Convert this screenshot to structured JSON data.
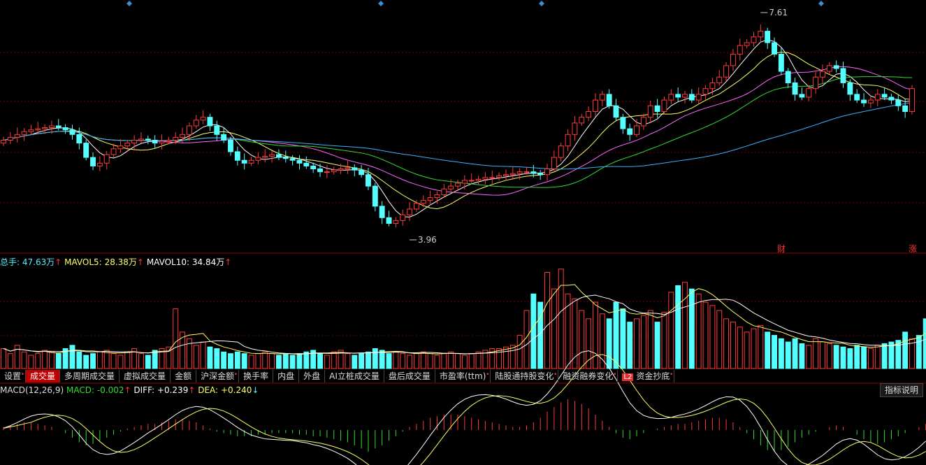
{
  "price_high_label": "7.61",
  "price_low_label": "3.96",
  "badge_cai": "财",
  "badge_zhang": "涨",
  "volume_legend": {
    "total_label": "总手:",
    "total_value": "47.63万",
    "mavol5_label": "MAVOL5:",
    "mavol5_value": "28.38万",
    "mavol10_label": "MAVOL10:",
    "mavol10_value": "34.84万",
    "arrow": "↑"
  },
  "tabs": [
    {
      "label": "设置",
      "dot": true
    },
    {
      "label": "成交量",
      "active": true
    },
    {
      "label": "多周期成交量"
    },
    {
      "label": "虚拟成交量"
    },
    {
      "label": "金额"
    },
    {
      "label": "沪深金额",
      "dot": true
    },
    {
      "label": "换手率"
    },
    {
      "label": "内盘"
    },
    {
      "label": "外盘"
    },
    {
      "label": "AI立桩成交量"
    },
    {
      "label": "盘后成交量"
    },
    {
      "label": "市盈率(ttm)",
      "dot": true
    },
    {
      "label": "陆股通持股变化",
      "dot": true
    },
    {
      "label": "融资融券变化",
      "dot": true
    },
    {
      "label": "资金抄底",
      "l2": "L2",
      "dot": true
    }
  ],
  "macd_legend": {
    "name": "MACD(12,26,9)",
    "macd_label": "MACD:",
    "macd_value": "-0.002",
    "diff_label": "DIFF:",
    "diff_value": "+0.239",
    "dea_label": "DEA:",
    "dea_value": "+0.240",
    "up_arrow": "↑",
    "down_arrow": "↓"
  },
  "help_button": "指标说明",
  "colors": {
    "up": "#ff3b3b",
    "down": "#54ffff",
    "ma5": "#ffffff",
    "ma10": "#ffff66",
    "ma20": "#ff66ff",
    "ma30": "#33dd33",
    "ma60": "#3ab0ff",
    "grid": "#7a0000",
    "macd_pos": "#ff3b3b",
    "macd_neg": "#33dd33"
  },
  "chart_data": {
    "type": "candlestick",
    "price_range": [
      3.96,
      7.61
    ],
    "closes": [
      5.5,
      5.55,
      5.6,
      5.65,
      5.68,
      5.7,
      5.72,
      5.75,
      5.72,
      5.68,
      5.6,
      5.45,
      5.2,
      5.05,
      5.1,
      5.25,
      5.35,
      5.4,
      5.45,
      5.5,
      5.52,
      5.5,
      5.45,
      5.48,
      5.5,
      5.55,
      5.6,
      5.75,
      5.85,
      5.9,
      5.75,
      5.6,
      5.5,
      5.3,
      5.15,
      5.1,
      5.15,
      5.2,
      5.22,
      5.25,
      5.2,
      5.18,
      5.15,
      5.1,
      5.05,
      5.0,
      4.95,
      4.95,
      4.98,
      5.0,
      5.02,
      4.98,
      4.9,
      4.7,
      4.35,
      4.15,
      4.05,
      4.1,
      4.2,
      4.3,
      4.4,
      4.45,
      4.5,
      4.55,
      4.65,
      4.7,
      4.75,
      4.8,
      4.8,
      4.82,
      4.85,
      4.85,
      4.88,
      4.9,
      4.92,
      4.95,
      4.95,
      4.92,
      4.9,
      5.0,
      5.2,
      5.4,
      5.6,
      5.8,
      5.9,
      6.0,
      6.2,
      6.3,
      6.1,
      5.9,
      5.7,
      5.6,
      5.75,
      5.9,
      6.1,
      6.0,
      6.2,
      6.3,
      6.25,
      6.3,
      6.2,
      6.3,
      6.4,
      6.5,
      6.6,
      6.8,
      7.0,
      7.15,
      7.2,
      7.3,
      7.4,
      7.2,
      7.0,
      6.7,
      6.5,
      6.3,
      6.25,
      6.4,
      6.6,
      6.7,
      6.8,
      6.75,
      6.5,
      6.3,
      6.2,
      6.15,
      6.2,
      6.3,
      6.25,
      6.2,
      6.1,
      6.0,
      6.4
    ],
    "volumes": [
      12,
      9,
      14,
      10,
      8,
      9,
      11,
      10,
      9,
      12,
      14,
      10,
      8,
      9,
      10,
      11,
      9,
      8,
      10,
      12,
      9,
      8,
      11,
      12,
      13,
      36,
      22,
      18,
      14,
      16,
      13,
      12,
      10,
      9,
      10,
      9,
      8,
      9,
      10,
      9,
      8,
      9,
      8,
      9,
      10,
      11,
      9,
      8,
      10,
      11,
      9,
      8,
      9,
      10,
      12,
      11,
      9,
      10,
      9,
      8,
      9,
      10,
      9,
      8,
      9,
      10,
      9,
      8,
      9,
      10,
      11,
      12,
      12,
      13,
      14,
      20,
      35,
      45,
      40,
      58,
      48,
      60,
      45,
      42,
      35,
      30,
      40,
      33,
      30,
      40,
      36,
      28,
      30,
      32,
      35,
      28,
      34,
      46,
      50,
      52,
      48,
      45,
      40,
      38,
      35,
      30,
      28,
      25,
      22,
      24,
      26,
      22,
      20,
      18,
      16,
      18,
      15,
      14,
      18,
      16,
      15,
      14,
      13,
      12,
      14,
      13,
      12,
      14,
      15,
      16,
      17,
      22,
      18,
      20,
      30
    ],
    "macd_hist": [
      0.02,
      0.03,
      0.04,
      0.05,
      0.05,
      0.04,
      0.03,
      0.02,
      0.0,
      -0.02,
      -0.05,
      -0.08,
      -0.1,
      -0.09,
      -0.07,
      -0.05,
      -0.03,
      -0.01,
      0.01,
      0.02,
      0.03,
      0.04,
      0.04,
      0.05,
      0.06,
      0.07,
      0.07,
      0.06,
      0.05,
      0.03,
      0.01,
      -0.01,
      -0.02,
      -0.03,
      -0.04,
      -0.04,
      -0.04,
      -0.03,
      -0.03,
      -0.02,
      -0.02,
      -0.02,
      -0.02,
      -0.03,
      -0.03,
      -0.04,
      -0.04,
      -0.05,
      -0.06,
      -0.07,
      -0.08,
      -0.1,
      -0.12,
      -0.14,
      -0.12,
      -0.1,
      -0.07,
      -0.04,
      -0.01,
      0.02,
      0.04,
      0.06,
      0.08,
      0.09,
      0.1,
      0.1,
      0.1,
      0.09,
      0.08,
      0.07,
      0.06,
      0.05,
      0.04,
      0.03,
      0.02,
      0.02,
      0.03,
      0.05,
      0.08,
      0.12,
      0.15,
      0.18,
      0.2,
      0.19,
      0.17,
      0.14,
      0.1,
      0.06,
      0.02,
      -0.02,
      -0.05,
      -0.06,
      -0.04,
      -0.02,
      0.0,
      0.01,
      0.02,
      0.03,
      0.04,
      0.04,
      0.05,
      0.06,
      0.07,
      0.08,
      0.08,
      0.07,
      0.05,
      0.02,
      -0.02,
      -0.06,
      -0.1,
      -0.13,
      -0.14,
      -0.13,
      -0.11,
      -0.08,
      -0.05,
      -0.03,
      -0.01,
      0.0,
      0.02,
      0.03,
      0.02,
      0.0,
      -0.03,
      -0.06,
      -0.08,
      -0.09,
      -0.08,
      -0.06,
      -0.04,
      -0.02,
      0.0,
      0.02,
      0.04
    ]
  }
}
